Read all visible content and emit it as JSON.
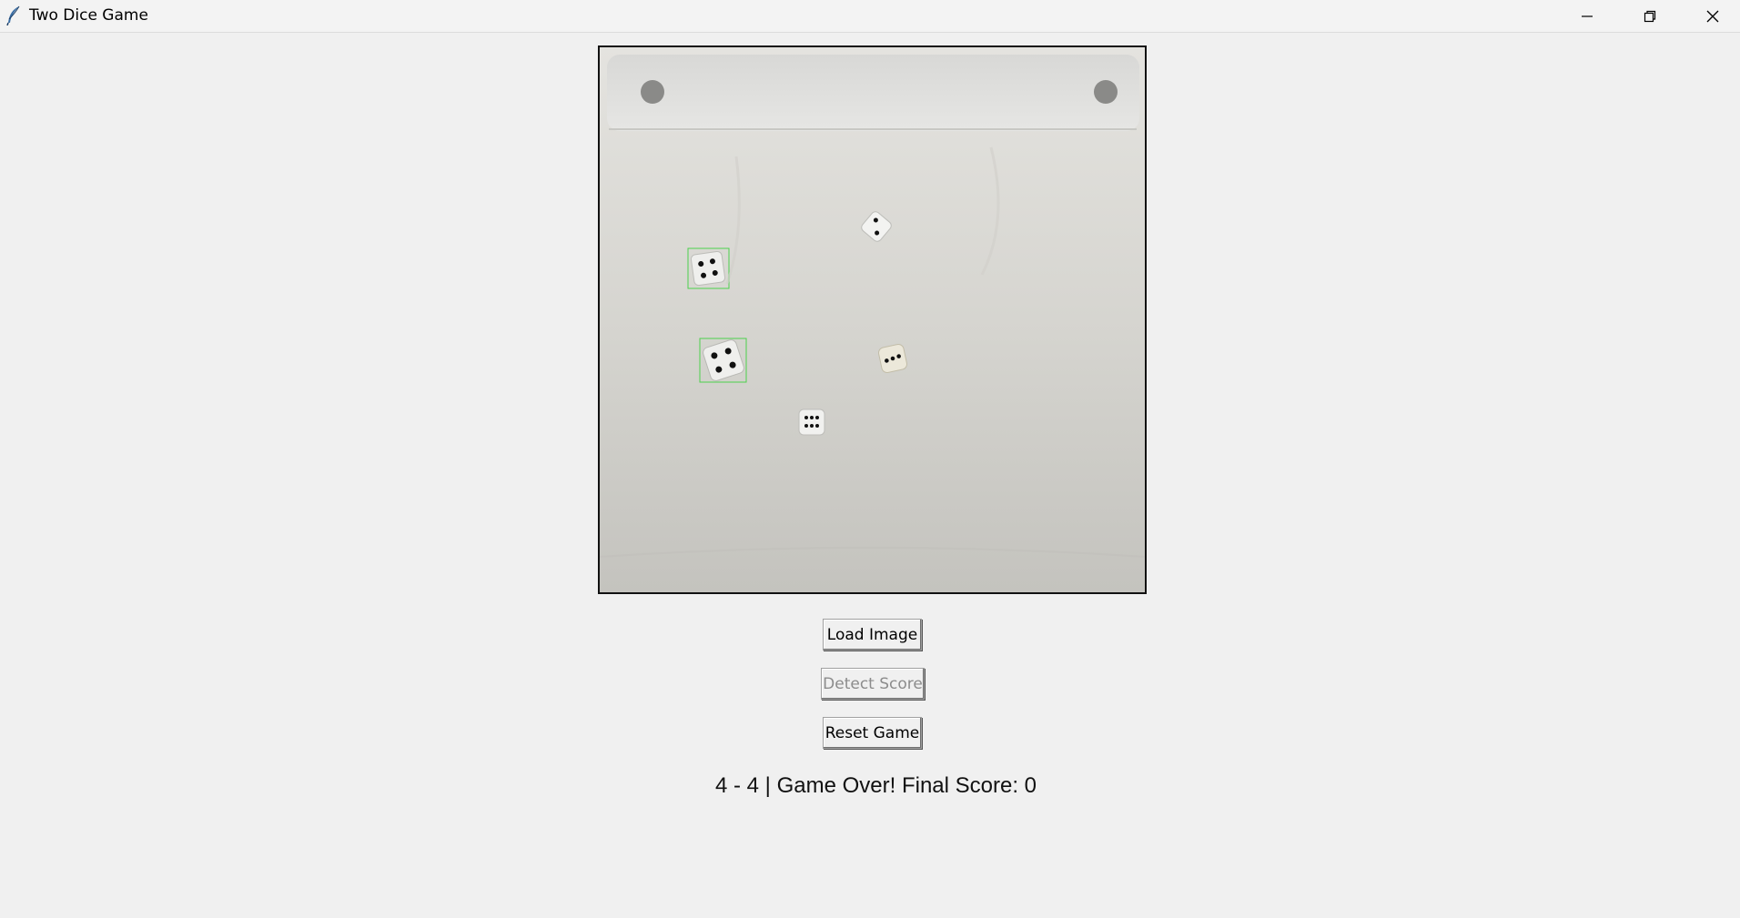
{
  "window": {
    "title": "Two Dice Game",
    "app_icon": "feather-icon",
    "controls": [
      "minimize-icon",
      "restore-icon",
      "close-icon"
    ]
  },
  "canvas": {
    "image_description_icon": "dice-photo",
    "detections": 2
  },
  "buttons": {
    "load_label": "Load Image",
    "detect_label": "Detect Score",
    "detect_enabled": false,
    "reset_label": "Reset Game"
  },
  "status": {
    "text": "4 - 4 | Game Over! Final Score: 0"
  },
  "colors": {
    "detection_box": "#4cd14c",
    "background": "#f0f0f0"
  }
}
